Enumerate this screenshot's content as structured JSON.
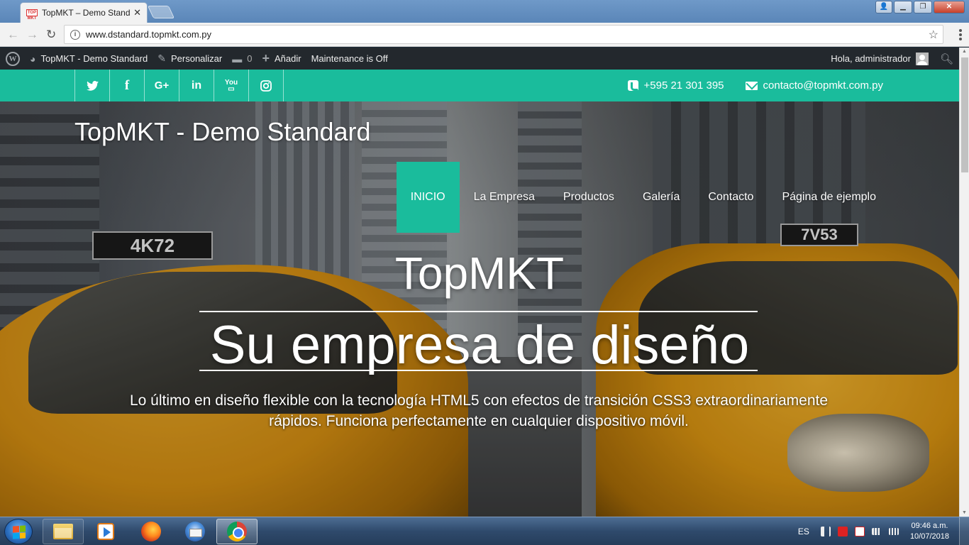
{
  "browser": {
    "tab_title": "TopMKT – Demo Standar",
    "tab_favicon_text": "TOP MKT",
    "url": "www.dstandard.topmkt.com.py"
  },
  "wp_admin_bar": {
    "site_name": "TopMKT - Demo Standard",
    "customize": "Personalizar",
    "comments_count": "0",
    "add_new": "Añadir",
    "maintenance": "Maintenance is Off",
    "greeting": "Hola, administrador"
  },
  "topbar": {
    "social": [
      {
        "name": "twitter",
        "glyph": "🐦"
      },
      {
        "name": "facebook",
        "glyph": "f"
      },
      {
        "name": "google-plus",
        "glyph": "G+"
      },
      {
        "name": "linkedin",
        "glyph": "in"
      },
      {
        "name": "youtube",
        "glyph": "You"
      },
      {
        "name": "instagram",
        "glyph": "◎"
      }
    ],
    "phone": "+595 21 301 395",
    "email": "contacto@topmkt.com.py"
  },
  "site": {
    "brand": "TopMKT - Demo Standard",
    "nav": [
      "INICIO",
      "La Empresa",
      "Productos",
      "Galería",
      "Contacto",
      "Página de ejemplo"
    ],
    "active_nav": "INICIO"
  },
  "hero": {
    "title": "TopMKT",
    "subtitle": "Su empresa de diseño",
    "description": "Lo último en diseño flexible con la tecnología HTML5 con efectos de transición CSS3 extraordinariamente rápidos. Funciona perfectamente en cualquier dispositivo móvil.",
    "taxi_left_plate": "4K72",
    "taxi_right_plate": "7V53"
  },
  "colors": {
    "accent": "#1abc9c",
    "wp_bar": "#23282d"
  },
  "taskbar": {
    "language": "ES",
    "time": "09:46 a.m.",
    "date": "10/07/2018",
    "apps": [
      "file-explorer",
      "media-player",
      "firefox",
      "thunderbird",
      "chrome"
    ],
    "active_app": "chrome"
  }
}
